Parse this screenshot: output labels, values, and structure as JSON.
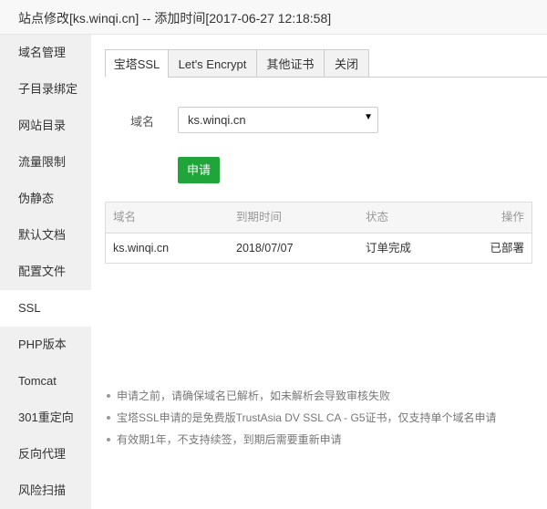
{
  "window": {
    "title": "站点修改[ks.winqi.cn] -- 添加时间[2017-06-27 12:18:58]"
  },
  "sidebar": {
    "items": [
      {
        "label": "域名管理"
      },
      {
        "label": "子目录绑定"
      },
      {
        "label": "网站目录"
      },
      {
        "label": "流量限制"
      },
      {
        "label": "伪静态"
      },
      {
        "label": "默认文档"
      },
      {
        "label": "配置文件"
      },
      {
        "label": "SSL"
      },
      {
        "label": "PHP版本"
      },
      {
        "label": "Tomcat"
      },
      {
        "label": "301重定向"
      },
      {
        "label": "反向代理"
      },
      {
        "label": "风险扫描"
      }
    ],
    "active": "SSL"
  },
  "tabs": [
    {
      "label": "宝塔SSL"
    },
    {
      "label": "Let's Encrypt"
    },
    {
      "label": "其他证书"
    },
    {
      "label": "关闭"
    }
  ],
  "form": {
    "domain_label": "域名",
    "domain_value": "ks.winqi.cn",
    "apply_button": "申请"
  },
  "table": {
    "headers": [
      "域名",
      "到期时间",
      "状态",
      "操作"
    ],
    "rows": [
      [
        "ks.winqi.cn",
        "2018/07/07",
        "订单完成",
        "已部署"
      ]
    ]
  },
  "tips": [
    "申请之前，请确保域名已解析，如未解析会导致审核失败",
    "宝塔SSL申请的是免费版TrustAsia DV SSL CA - G5证书，仅支持单个域名申请",
    "有效期1年，不支持续签，到期后需要重新申请"
  ],
  "colors": {
    "primary_button": "#20a53a",
    "sidebar_bg": "#f0f0f0"
  }
}
